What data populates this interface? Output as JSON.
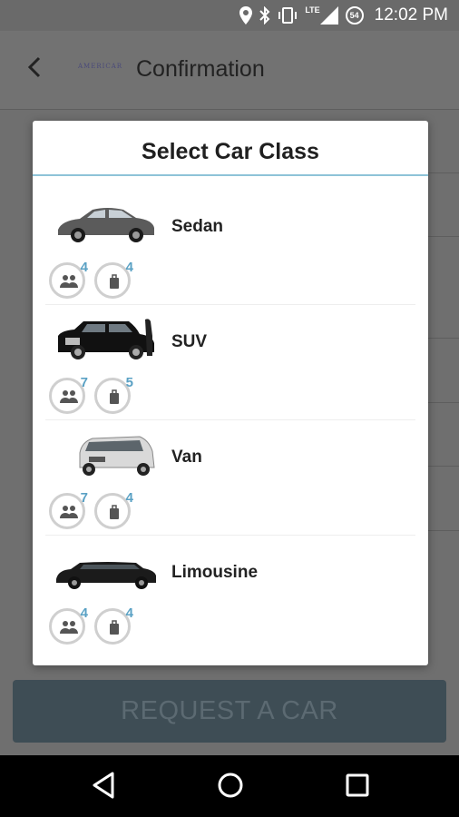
{
  "status_bar": {
    "time": "12:02 PM",
    "network": "LTE",
    "notification_badge": "54"
  },
  "app_bar": {
    "back_icon": "back-arrow-icon",
    "logo_text": "AMERICAR",
    "title": "Confirmation"
  },
  "dialog": {
    "title": "Select Car Class",
    "accent_color": "#8ec3d8",
    "cars": [
      {
        "name": "Sedan",
        "passengers": "4",
        "luggage": "4"
      },
      {
        "name": "SUV",
        "passengers": "7",
        "luggage": "5"
      },
      {
        "name": "Van",
        "passengers": "7",
        "luggage": "4"
      },
      {
        "name": "Limousine",
        "passengers": "4",
        "luggage": "4"
      }
    ]
  },
  "request_button": {
    "label": "REQUEST A CAR"
  },
  "nav_bar": {
    "icons": [
      "back-triangle-icon",
      "home-circle-icon",
      "recents-square-icon"
    ]
  }
}
